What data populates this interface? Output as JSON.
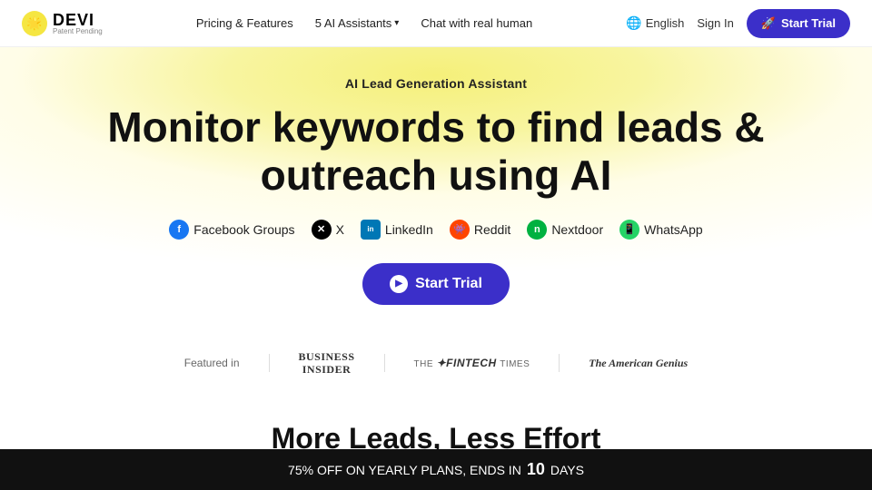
{
  "logo": {
    "icon": "🌟",
    "name": "DEVI",
    "sub": "Patent Pending"
  },
  "nav": {
    "links": [
      {
        "label": "Pricing & Features",
        "dropdown": false
      },
      {
        "label": "5 AI Assistants",
        "dropdown": true
      },
      {
        "label": "Chat with real human",
        "dropdown": false
      }
    ],
    "lang": "English",
    "signin": "Sign In",
    "trial_btn": "Start Trial"
  },
  "hero": {
    "subtitle": "AI Lead Generation Assistant",
    "title_line1": "Monitor keywords to find leads &",
    "title_line2": "outreach using AI",
    "platforms": [
      {
        "name": "Facebook Groups",
        "type": "fb",
        "icon": "f",
        "prefix": ""
      },
      {
        "name": "X",
        "type": "x",
        "icon": "𝕏",
        "prefix": ""
      },
      {
        "name": "LinkedIn",
        "type": "li",
        "icon": "in",
        "prefix": ""
      },
      {
        "name": "Reddit",
        "type": "rd",
        "icon": "r",
        "prefix": ""
      },
      {
        "name": "Nextdoor",
        "type": "nd",
        "icon": "n",
        "prefix": ""
      },
      {
        "name": "WhatsApp",
        "type": "wa",
        "icon": "w",
        "prefix": ""
      }
    ],
    "cta_label": "Start Trial"
  },
  "featured": {
    "label": "Featured in",
    "logos": [
      {
        "text": "BUSINESS\nINSIDER",
        "cls": "bi"
      },
      {
        "text": "THE FINTECH TIMES",
        "cls": "fintech"
      },
      {
        "text": "The American Genius",
        "cls": "ag"
      }
    ]
  },
  "more_leads": {
    "title": "More Leads, Less Effort"
  },
  "banner": {
    "text": "75% OFF ON YEARLY PLANS, ENDS IN",
    "number": "10",
    "suffix": "DAYS"
  }
}
